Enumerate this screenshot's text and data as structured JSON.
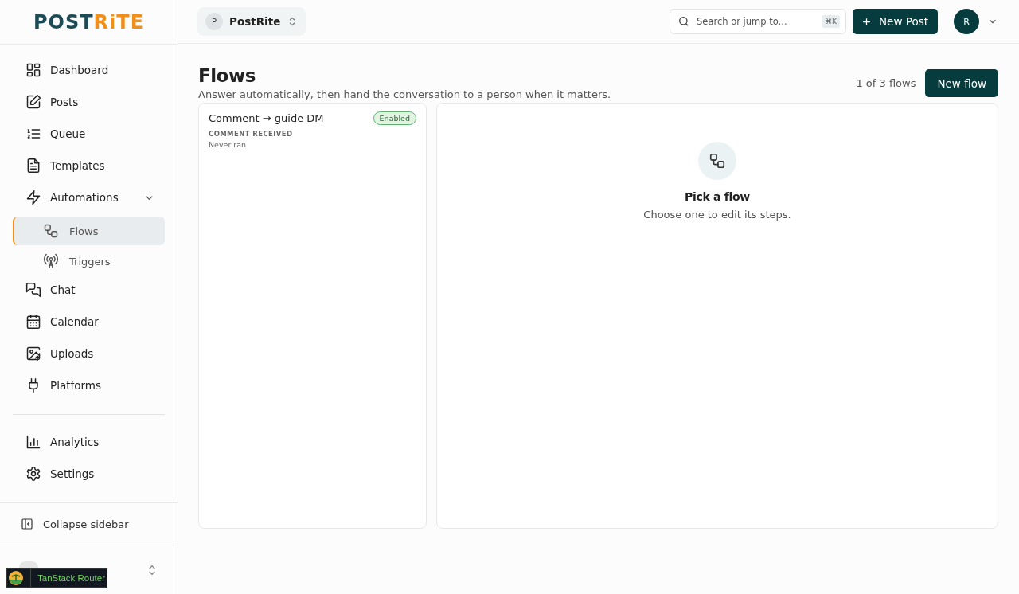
{
  "logo": {
    "part_1": "POST",
    "part_2": "RiTE"
  },
  "sidebar": {
    "items": [
      {
        "label": "Dashboard",
        "selected": false
      },
      {
        "label": "Posts",
        "selected": false
      },
      {
        "label": "Queue",
        "selected": false
      },
      {
        "label": "Templates",
        "selected": false
      },
      {
        "label": "Automations",
        "selected": false,
        "expanded": true,
        "children": [
          {
            "label": "Flows",
            "selected": true
          },
          {
            "label": "Triggers",
            "selected": false
          }
        ]
      },
      {
        "label": "Chat",
        "selected": false
      },
      {
        "label": "Calendar",
        "selected": false
      },
      {
        "label": "Uploads",
        "selected": false
      },
      {
        "label": "Platforms",
        "selected": false
      }
    ],
    "secondary_items": [
      {
        "label": "Analytics",
        "selected": false
      },
      {
        "label": "Settings",
        "selected": false
      }
    ],
    "collapse": "Collapse sidebar"
  },
  "devtools_badge": "TanStack Router",
  "workspace": {
    "initial": "P",
    "name": "PostRite"
  },
  "search": {
    "placeholder": "Search or jump to...",
    "shortcut": "⌘K"
  },
  "new_post": "New Post",
  "user": {
    "initial": "R"
  },
  "page": {
    "title": "Flows",
    "subtitle": "Answer automatically, then hand the conversation to a person when it matters.",
    "count": "1 of 3 flows",
    "new_button": "New flow"
  },
  "flows": [
    {
      "name": "Comment → guide DM",
      "status": "Enabled",
      "enabled": true,
      "trigger": "COMMENT RECEIVED",
      "last_run": "Never ran",
      "selected": false
    }
  ],
  "empty_state": {
    "title": "Pick a flow",
    "text": "Choose one to edit its steps."
  }
}
